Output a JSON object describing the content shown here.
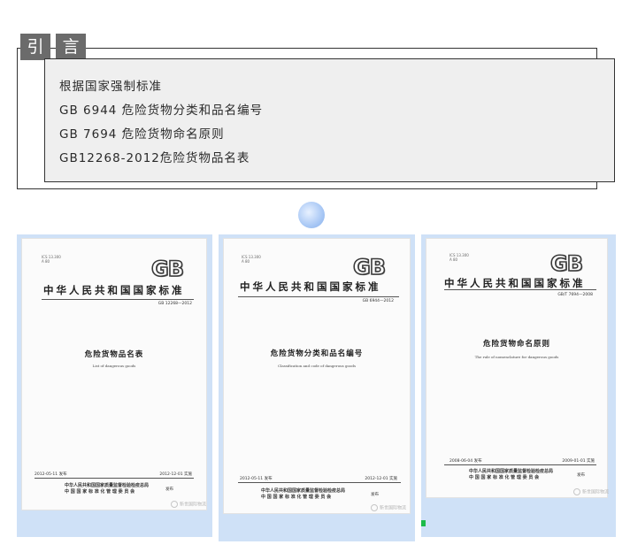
{
  "intro": {
    "title_chars": [
      "引",
      "言"
    ],
    "lines": [
      "根据国家强制标准",
      "GB 6944 危险货物分类和品名编号",
      "GB 7694 危险货物命名原则",
      "GB12268-2012危险货物品名表"
    ]
  },
  "covers": [
    {
      "logo": "GB",
      "standard_name": "中华人民共和国国家标准",
      "code": "GB 12268—2012",
      "title": "危险货物品名表",
      "subtitle": "List of dangerous goods",
      "issue_date": "2012-05-11 发布",
      "effective_date": "2012-12-01 实施",
      "issuer_line1": "中华人民共和国国家质量监督检验检疫总局",
      "issuer_line2": "中 国 国 家 标 准 化 管 理 委 员 会",
      "publish": "发布",
      "watermark": "新世国际物流"
    },
    {
      "logo": "GB",
      "standard_name": "中华人民共和国国家标准",
      "code": "GB 6944—2012",
      "title": "危险货物分类和品名编号",
      "subtitle": "Classification and code of dangerous goods",
      "issue_date": "2012-05-11 发布",
      "effective_date": "2012-12-01 实施",
      "issuer_line1": "中华人民共和国国家质量监督检验检疫总局",
      "issuer_line2": "中 国 国 家 标 准 化 管 理 委 员 会",
      "publish": "发布",
      "watermark": "新世国际物流"
    },
    {
      "logo": "GB",
      "standard_name": "中华人民共和国国家标准",
      "code": "GB/T 7694—2008",
      "title": "危险货物命名原则",
      "subtitle": "The rule of nomenclature for dangerous goods",
      "issue_date": "2008-06-04 发布",
      "effective_date": "2009-01-01 实施",
      "issuer_line1": "中华人民共和国国家质量监督检验检疫总局",
      "issuer_line2": "中 国 国 家 标 准 化 管 理 委 员 会",
      "publish": "发布",
      "watermark": "新世国际物流"
    }
  ],
  "colors": {
    "title_bg": "#6b6b6b",
    "panel_bg": "#efefef",
    "cover_backdrop": "#cfe1f7",
    "bubble": "#a9c8f5",
    "green_mark": "#1dbb4a"
  }
}
